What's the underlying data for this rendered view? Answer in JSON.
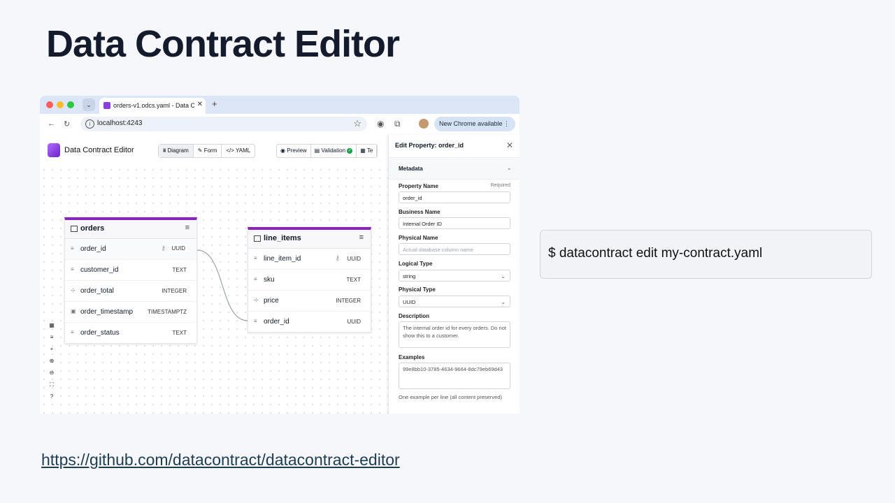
{
  "slide": {
    "title": "Data Contract Editor",
    "command": "$ datacontract edit my-contract.yaml",
    "link": "https://github.com/datacontract/datacontract-editor"
  },
  "browser": {
    "tab_title": "orders-v1.odcs.yaml - Data C",
    "url": "localhost:4243",
    "update_label": "New Chrome available",
    "window_controls_colors": [
      "#ff5f57",
      "#febc2e",
      "#28c840"
    ]
  },
  "app": {
    "name": "Data Contract Editor",
    "views": [
      "Diagram",
      "Form",
      "YAML"
    ],
    "actions": [
      "Preview",
      "Validation",
      "Te"
    ],
    "accent": "#8a22c4"
  },
  "tables": [
    {
      "name": "orders",
      "rows": [
        {
          "name": "order_id",
          "type": "UUID",
          "key": true
        },
        {
          "name": "customer_id",
          "type": "TEXT",
          "key": false
        },
        {
          "name": "order_total",
          "type": "INTEGER",
          "key": false
        },
        {
          "name": "order_timestamp",
          "type": "TIMESTAMPTZ",
          "key": false
        },
        {
          "name": "order_status",
          "type": "TEXT",
          "key": false
        }
      ]
    },
    {
      "name": "line_items",
      "rows": [
        {
          "name": "line_item_id",
          "type": "UUID",
          "key": true
        },
        {
          "name": "sku",
          "type": "TEXT",
          "key": false
        },
        {
          "name": "price",
          "type": "INTEGER",
          "key": false
        },
        {
          "name": "order_id",
          "type": "UUID",
          "key": false
        }
      ]
    }
  ],
  "panel": {
    "title": "Edit Property: order_id",
    "section": "Metadata",
    "property_name_label": "Property Name",
    "required_label": "Required",
    "property_name_value": "order_id",
    "business_name_label": "Business Name",
    "business_name_value": "Internal Order ID",
    "physical_name_label": "Physical Name",
    "physical_name_placeholder": "Actual database column name",
    "logical_type_label": "Logical Type",
    "logical_type_value": "string",
    "physical_type_label": "Physical Type",
    "physical_type_value": "UUID",
    "description_label": "Description",
    "description_value": "The internal order id for every orders. Do not show this to a customer.",
    "examples_label": "Examples",
    "examples_value": "99e8bb10-3785-4634-9664-8dc79eb69d43",
    "examples_help": "One example per line (all content preserved)"
  }
}
